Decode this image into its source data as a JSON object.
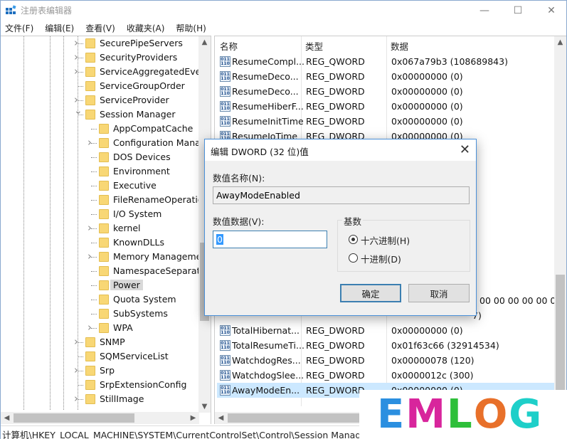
{
  "window": {
    "title": "注册表编辑器",
    "controls": {
      "minimize": "—",
      "maximize": "☐",
      "close": "✕"
    }
  },
  "menu": [
    "文件(F)",
    "编辑(E)",
    "查看(V)",
    "收藏夹(A)",
    "帮助(H)"
  ],
  "tree": {
    "items": [
      {
        "label": "SecurePipeServers",
        "level": 0,
        "expander": "collapsed"
      },
      {
        "label": "SecurityProviders",
        "level": 0,
        "expander": "collapsed"
      },
      {
        "label": "ServiceAggregatedEven",
        "level": 0,
        "expander": "collapsed"
      },
      {
        "label": "ServiceGroupOrder",
        "level": 0,
        "expander": "none"
      },
      {
        "label": "ServiceProvider",
        "level": 0,
        "expander": "collapsed"
      },
      {
        "label": "Session Manager",
        "level": 0,
        "expander": "expanded"
      },
      {
        "label": "AppCompatCache",
        "level": 1,
        "expander": "none"
      },
      {
        "label": "Configuration Manag",
        "level": 1,
        "expander": "collapsed"
      },
      {
        "label": "DOS Devices",
        "level": 1,
        "expander": "none"
      },
      {
        "label": "Environment",
        "level": 1,
        "expander": "none"
      },
      {
        "label": "Executive",
        "level": 1,
        "expander": "none"
      },
      {
        "label": "FileRenameOperatio",
        "level": 1,
        "expander": "none"
      },
      {
        "label": "I/O System",
        "level": 1,
        "expander": "none"
      },
      {
        "label": "kernel",
        "level": 1,
        "expander": "collapsed"
      },
      {
        "label": "KnownDLLs",
        "level": 1,
        "expander": "none"
      },
      {
        "label": "Memory Manageme",
        "level": 1,
        "expander": "collapsed"
      },
      {
        "label": "NamespaceSeparatio",
        "level": 1,
        "expander": "none"
      },
      {
        "label": "Power",
        "level": 1,
        "expander": "none",
        "selected": true
      },
      {
        "label": "Quota System",
        "level": 1,
        "expander": "none"
      },
      {
        "label": "SubSystems",
        "level": 1,
        "expander": "none"
      },
      {
        "label": "WPA",
        "level": 1,
        "expander": "collapsed"
      },
      {
        "label": "SNMP",
        "level": 0,
        "expander": "collapsed"
      },
      {
        "label": "SQMServiceList",
        "level": 0,
        "expander": "none"
      },
      {
        "label": "Srp",
        "level": 0,
        "expander": "collapsed"
      },
      {
        "label": "SrpExtensionConfig",
        "level": 0,
        "expander": "none"
      },
      {
        "label": "StillImage",
        "level": 0,
        "expander": "collapsed"
      }
    ]
  },
  "list": {
    "columns": [
      "名称",
      "类型",
      "数据"
    ],
    "rows_top": [
      {
        "name": "ResumeCompl...",
        "type": "REG_QWORD",
        "data": "0x067a79b3 (108689843)"
      },
      {
        "name": "ResumeDeco...",
        "type": "REG_DWORD",
        "data": "0x00000000 (0)"
      },
      {
        "name": "ResumeDeco...",
        "type": "REG_DWORD",
        "data": "0x00000000 (0)"
      },
      {
        "name": "ResumeHiberF...",
        "type": "REG_DWORD",
        "data": "0x00000000 (0)"
      },
      {
        "name": "ResumeInitTime",
        "type": "REG_DWORD",
        "data": "0x00000000 (0)"
      },
      {
        "name": "ResumeIoTime",
        "type": "REG_DWORD",
        "data": "0x00000000 (0)"
      }
    ],
    "partial_fragments": [
      ")",
      "00 00 00 00 00 00",
      "7)"
    ],
    "rows_bottom": [
      {
        "name": "TotalHibernat...",
        "type": "REG_DWORD",
        "data": "0x00000000 (0)"
      },
      {
        "name": "TotalResumeTi...",
        "type": "REG_DWORD",
        "data": "0x01f63c66 (32914534)"
      },
      {
        "name": "WatchdogRes...",
        "type": "REG_DWORD",
        "data": "0x00000078 (120)"
      },
      {
        "name": "WatchdogSlee...",
        "type": "REG_DWORD",
        "data": "0x0000012c (300)"
      },
      {
        "name": "AwayModeEn...",
        "type": "REG_DWORD",
        "data": "0x00000000 (0)",
        "selected": true
      }
    ]
  },
  "status": {
    "path": "计算机\\HKEY_LOCAL_MACHINE\\SYSTEM\\CurrentControlSet\\Control\\Session Manager\\P"
  },
  "dialog": {
    "title": "编辑 DWORD (32 位)值",
    "name_label": "数值名称(N):",
    "name_value": "AwayModeEnabled",
    "data_label": "数值数据(V):",
    "data_value": "0",
    "base_label": "基数",
    "radio_hex": "十六进制(H)",
    "radio_dec": "十进制(D)",
    "selected_base": "hex",
    "ok": "确定",
    "cancel": "取消"
  },
  "watermark": {
    "letters": [
      {
        "char": "E",
        "color": "#2b8fe0"
      },
      {
        "char": "M",
        "color": "#d8259c"
      },
      {
        "char": "L",
        "color": "#2ebf3a"
      },
      {
        "char": "O",
        "color": "#e8702a"
      },
      {
        "char": "G",
        "color": "#1ecfc9"
      }
    ]
  }
}
